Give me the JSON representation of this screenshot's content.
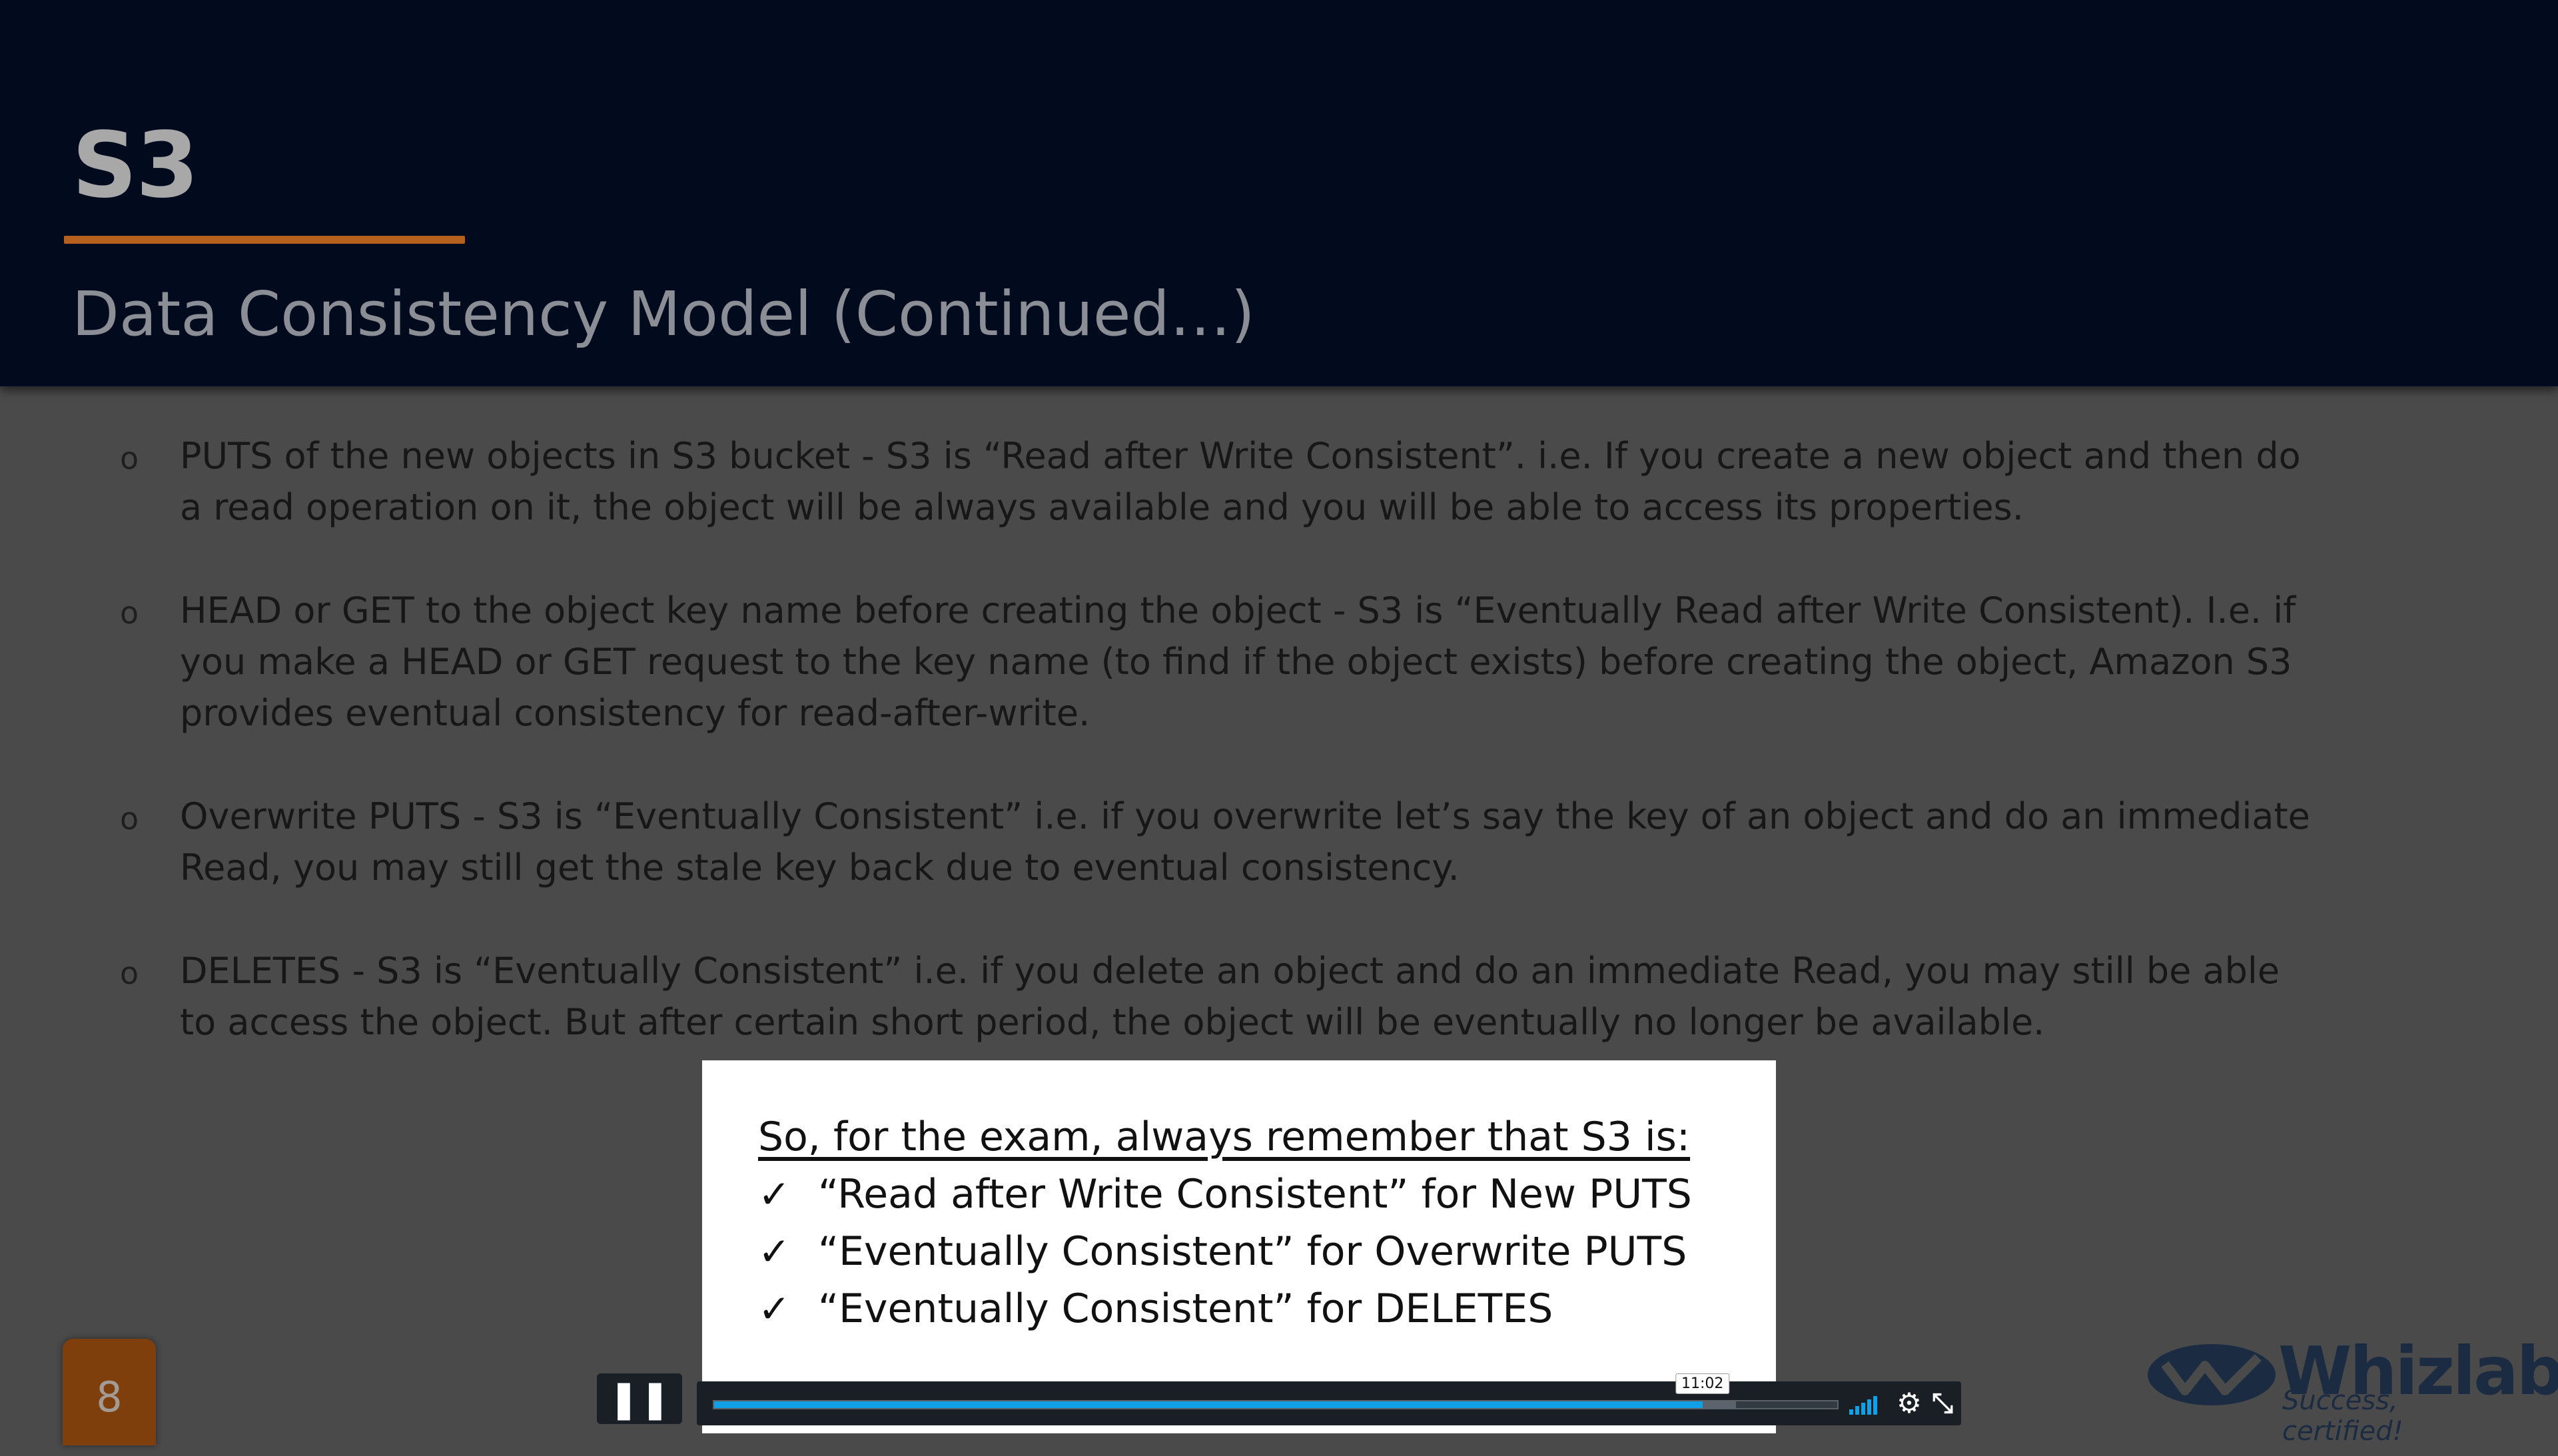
{
  "slide": {
    "title": "S3",
    "subtitle": "Data Consistency Model (Continued…)",
    "bullets": [
      "PUTS of the new objects in S3 bucket - S3 is “Read after Write Consistent”. i.e. If you create a new object and then do a read operation on it, the object will be always available and you will be able to access its properties.",
      "HEAD or GET to the object key name before creating the object - S3 is “Eventually Read after Write Consistent). I.e. if you make a HEAD or GET request to the key name (to find if the object exists) before creating the object, Amazon S3 provides eventual consistency for read-after-write.",
      "Overwrite PUTS - S3 is “Eventually Consistent” i.e. if you overwrite let’s say the key of an object and do an immediate Read, you may still get the stale key back due to eventual consistency.",
      "DELETES - S3 is “Eventually Consistent” i.e. if you delete an object and do an immediate Read, you may still be able to access the object. But after certain short period, the object will be eventually no longer be available."
    ],
    "bullet_marker": "o",
    "page_number": "8",
    "logo_text": "Whizlabs",
    "logo_tagline": "Success, certified!"
  },
  "note": {
    "heading": "So, for the exam, always remember that S3 is:",
    "check_mark": "✓",
    "items": [
      "“Read after Write Consistent” for New PUTS",
      "“Eventually Consistent” for Overwrite PUTS",
      "“Eventually Consistent” for DELETES"
    ]
  },
  "player": {
    "pause_icon": "pause-icon",
    "current_time": "11:02",
    "progress_fraction": 0.88,
    "buffered_fraction": 0.91,
    "accent_color": "#11a0e6"
  }
}
